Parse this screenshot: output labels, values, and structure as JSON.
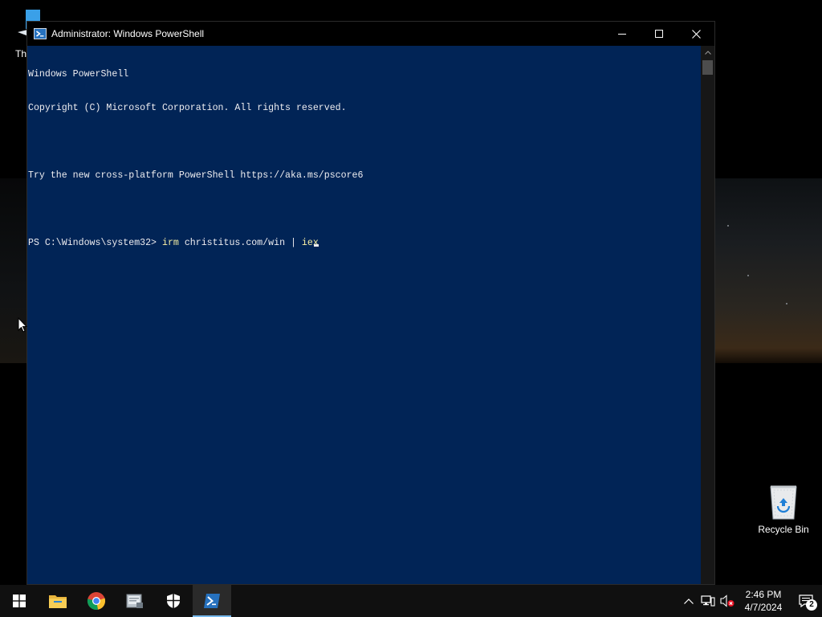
{
  "desktop": {
    "icons": {
      "this_pc_label": "Th",
      "recycle_bin_label": "Recycle Bin"
    }
  },
  "window": {
    "title": "Administrator: Windows PowerShell",
    "icon": "powershell-icon",
    "controls": [
      "minimize",
      "maximize",
      "close"
    ],
    "background": "#012456"
  },
  "console": {
    "lines": [
      "Windows PowerShell",
      "Copyright (C) Microsoft Corporation. All rights reserved.",
      "",
      "Try the new cross-platform PowerShell https://aka.ms/pscore6",
      ""
    ],
    "prompt": "PS C:\\Windows\\system32> ",
    "cmd_irm": "irm",
    "cmd_middle": " christitus.com/win | ",
    "cmd_iex": "iex",
    "command_color": "#f9f1a5"
  },
  "taskbar": {
    "apps": [
      "start-icon",
      "file-explorer-icon",
      "chrome-icon",
      "server-manager-icon",
      "windows-security-icon",
      "powershell-icon"
    ],
    "active_app": "powershell-icon",
    "clock_time": "2:46 PM",
    "clock_date": "4/7/2024",
    "notification_count": "2"
  }
}
